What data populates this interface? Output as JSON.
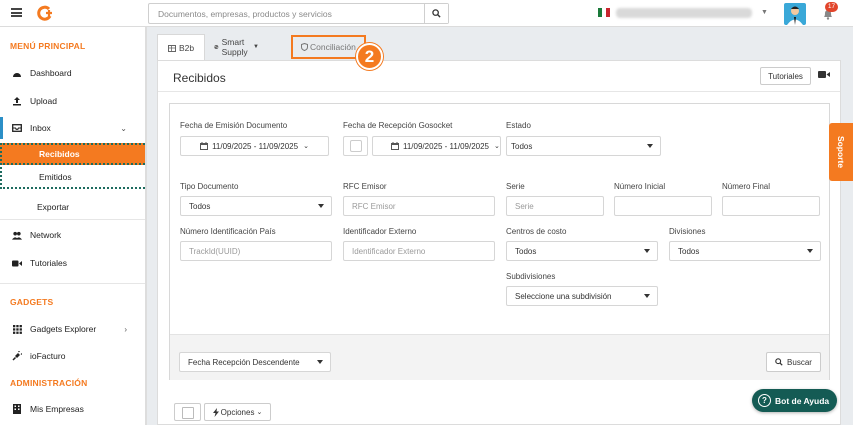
{
  "topbar": {
    "search_placeholder": "Documentos, empresas, productos y servicios",
    "notification_count": "17"
  },
  "sidebar": {
    "sections": [
      {
        "title": "MENÚ PRINCIPAL",
        "items": [
          {
            "label": "Dashboard",
            "icon": "dashboard-icon"
          },
          {
            "label": "Upload",
            "icon": "upload-icon"
          },
          {
            "label": "Inbox",
            "icon": "inbox-icon",
            "expanded": true,
            "children": [
              {
                "label": "Recibidos",
                "active": true
              },
              {
                "label": "Emitidos"
              },
              {
                "label": "Exportar"
              }
            ]
          },
          {
            "label": "Network",
            "icon": "users-icon"
          },
          {
            "label": "Tutoriales",
            "icon": "video-icon"
          }
        ]
      },
      {
        "title": "GADGETS",
        "items": [
          {
            "label": "Gadgets Explorer",
            "icon": "grid-icon"
          },
          {
            "label": "ioFacturo",
            "icon": "plug-icon"
          }
        ]
      },
      {
        "title": "ADMINISTRACIÓN",
        "items": [
          {
            "label": "Mis Empresas",
            "icon": "building-icon"
          }
        ]
      }
    ]
  },
  "tabs": [
    {
      "label": "B2b",
      "icon": "table-icon",
      "active": true
    },
    {
      "label": "Smart Supply",
      "icon": "globe-icon",
      "dropdown": true
    },
    {
      "label": "Conciliación",
      "icon": "shield-icon",
      "highlighted": true
    }
  ],
  "step_badge": "2",
  "panel": {
    "title": "Recibidos",
    "tutorial_button": "Tutoriales"
  },
  "filters": {
    "fecha_emision": {
      "label": "Fecha de Emisión Documento",
      "value": "11/09/2025 - 11/09/2025"
    },
    "fecha_recepcion": {
      "label": "Fecha de Recepción Gosocket",
      "value": "11/09/2025 - 11/09/2025"
    },
    "estado": {
      "label": "Estado",
      "value": "Todos"
    },
    "tipo_documento": {
      "label": "Tipo Documento",
      "value": "Todos"
    },
    "rfc_emisor": {
      "label": "RFC Emisor",
      "placeholder": "RFC Emisor"
    },
    "serie": {
      "label": "Serie",
      "placeholder": "Serie"
    },
    "numero_inicial": {
      "label": "Número Inicial",
      "placeholder": ""
    },
    "numero_final": {
      "label": "Número Final",
      "placeholder": ""
    },
    "numero_identificacion": {
      "label": "Número Identificación País",
      "placeholder": "TrackId(UUID)"
    },
    "identificador_externo": {
      "label": "Identificador Externo",
      "placeholder": "Identificador Externo"
    },
    "centros_costo": {
      "label": "Centros de costo",
      "value": "Todos"
    },
    "divisiones": {
      "label": "Divisiones",
      "value": "Todos"
    },
    "subdivisiones": {
      "label": "Subdivisiones",
      "value": "Seleccione una subdivisión"
    },
    "sort": {
      "value": "Fecha Recepción Descendente"
    },
    "buscar_label": "Buscar"
  },
  "bottom": {
    "opciones_label": "Opciones"
  },
  "floating": {
    "soporte_label": "Soporte",
    "bot_label": "Bot de Ayuda"
  },
  "colors": {
    "accent": "#f47a20",
    "bot_bg": "#145b54",
    "inbox_marker": "#2b8fc7",
    "dotted_outline": "#1d6b5e"
  }
}
